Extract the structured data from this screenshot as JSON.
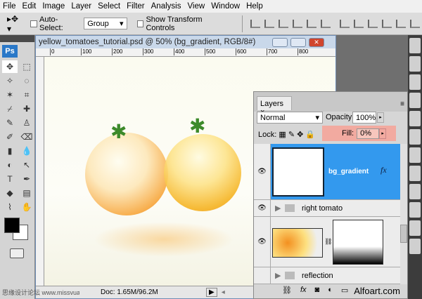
{
  "menu": [
    "File",
    "Edit",
    "Image",
    "Layer",
    "Select",
    "Filter",
    "Analysis",
    "View",
    "Window",
    "Help"
  ],
  "options": {
    "auto_select_label": "Auto-Select:",
    "auto_select_value": "Group",
    "show_transform_label": "Show Transform Controls",
    "auto_select_checked": false,
    "show_transform_checked": false
  },
  "tools": {
    "logo": "Ps",
    "icons": [
      "move-icon",
      "marquee-icon",
      "lasso-icon",
      "magic-wand-icon",
      "crop-icon",
      "slice-icon",
      "healing-icon",
      "brush-icon",
      "stamp-icon",
      "history-brush-icon",
      "eraser-icon",
      "gradient-icon",
      "blur-icon",
      "dodge-icon",
      "path-select-icon",
      "type-icon",
      "pen-icon",
      "shape-icon",
      "notes-icon",
      "eyedropper-icon",
      "hand-icon",
      "zoom-icon"
    ],
    "glyphs": [
      "▸",
      "✥",
      "⬚",
      "✧",
      "◌",
      "✶",
      "⌗",
      "⌿",
      "✚",
      "✎",
      "♙",
      "✐",
      "⌫",
      "▮",
      "💧",
      "◐",
      "↖",
      "T",
      "✒",
      "◆",
      "▤",
      "⌇",
      "✋",
      "🔍"
    ],
    "foreground": "#000000",
    "background": "#ffffff"
  },
  "document": {
    "title": "yellow_tomatoes_tutorial.psd @ 50% (bg_gradient, RGB/8#)",
    "ruler": [
      "0",
      "100",
      "200",
      "300",
      "400",
      "500",
      "600",
      "700",
      "800"
    ],
    "status": "Doc: 1.65M/96.2M",
    "watermark": "思缘设计论坛 www.missvuan.com"
  },
  "layers": {
    "tab": "Layers",
    "blend_mode": "Normal",
    "opacity_label": "Opacity:",
    "opacity": "100%",
    "lock_label": "Lock:",
    "fill_label": "Fill:",
    "fill": "0%",
    "highlight_color": "#f2aaa0",
    "selected_color": "#3399ee",
    "items": [
      {
        "name": "bg_gradient",
        "visible": true,
        "selected": true,
        "fx": "fx"
      },
      {
        "name": "right tomato",
        "visible": true,
        "group": true
      },
      {
        "name": "",
        "visible": true,
        "mask": true
      },
      {
        "name": "reflection",
        "visible": false,
        "group": true
      }
    ]
  },
  "brand": "Alfoart.com"
}
